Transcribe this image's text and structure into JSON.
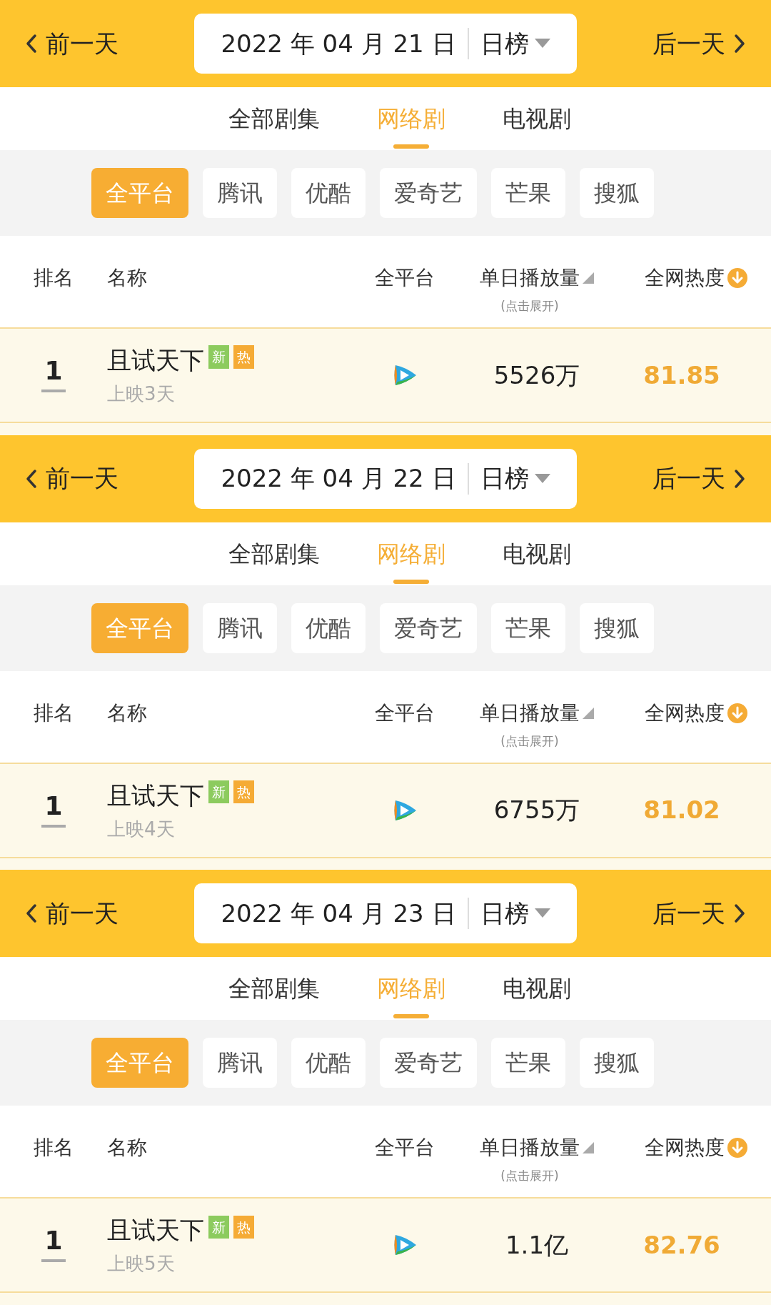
{
  "panels": [
    {
      "prev_day": "前一天",
      "date": "2022 年 04 月 21 日",
      "period": "日榜",
      "next_day": "后一天",
      "tabs": [
        {
          "label": "全部剧集",
          "selected": false
        },
        {
          "label": "网络剧",
          "selected": true
        },
        {
          "label": "电视剧",
          "selected": false
        }
      ],
      "platforms": [
        {
          "label": "全平台",
          "selected": true
        },
        {
          "label": "腾讯",
          "selected": false
        },
        {
          "label": "优酷",
          "selected": false
        },
        {
          "label": "爱奇艺",
          "selected": false
        },
        {
          "label": "芒果",
          "selected": false
        },
        {
          "label": "搜狐",
          "selected": false
        }
      ],
      "columns": [
        "排名",
        "名称",
        "全平台",
        "单日播放量",
        "全网热度"
      ],
      "expand_hint": "(点击展开)",
      "rows": [
        {
          "rank": "1",
          "title": "且试天下",
          "badges": [
            {
              "label": "新",
              "color": "#8ccb5e"
            },
            {
              "label": "热",
              "color": "#f5ab35"
            }
          ],
          "subtitle": "上映3天",
          "plays": "5526万",
          "heat": "81.85"
        }
      ]
    },
    {
      "prev_day": "前一天",
      "date": "2022 年 04 月 22 日",
      "period": "日榜",
      "next_day": "后一天",
      "tabs": [
        {
          "label": "全部剧集",
          "selected": false
        },
        {
          "label": "网络剧",
          "selected": true
        },
        {
          "label": "电视剧",
          "selected": false
        }
      ],
      "platforms": [
        {
          "label": "全平台",
          "selected": true
        },
        {
          "label": "腾讯",
          "selected": false
        },
        {
          "label": "优酷",
          "selected": false
        },
        {
          "label": "爱奇艺",
          "selected": false
        },
        {
          "label": "芒果",
          "selected": false
        },
        {
          "label": "搜狐",
          "selected": false
        }
      ],
      "columns": [
        "排名",
        "名称",
        "全平台",
        "单日播放量",
        "全网热度"
      ],
      "expand_hint": "(点击展开)",
      "rows": [
        {
          "rank": "1",
          "title": "且试天下",
          "badges": [
            {
              "label": "新",
              "color": "#8ccb5e"
            },
            {
              "label": "热",
              "color": "#f5ab35"
            }
          ],
          "subtitle": "上映4天",
          "plays": "6755万",
          "heat": "81.02"
        }
      ]
    },
    {
      "prev_day": "前一天",
      "date": "2022 年 04 月 23 日",
      "period": "日榜",
      "next_day": "后一天",
      "tabs": [
        {
          "label": "全部剧集",
          "selected": false
        },
        {
          "label": "网络剧",
          "selected": true
        },
        {
          "label": "电视剧",
          "selected": false
        }
      ],
      "platforms": [
        {
          "label": "全平台",
          "selected": true
        },
        {
          "label": "腾讯",
          "selected": false
        },
        {
          "label": "优酷",
          "selected": false
        },
        {
          "label": "爱奇艺",
          "selected": false
        },
        {
          "label": "芒果",
          "selected": false
        },
        {
          "label": "搜狐",
          "selected": false
        }
      ],
      "columns": [
        "排名",
        "名称",
        "全平台",
        "单日播放量",
        "全网热度"
      ],
      "expand_hint": "(点击展开)",
      "rows": [
        {
          "rank": "1",
          "title": "且试天下",
          "badges": [
            {
              "label": "新",
              "color": "#8ccb5e"
            },
            {
              "label": "热",
              "color": "#f5ab35"
            }
          ],
          "subtitle": "上映5天",
          "plays": "1.1亿",
          "heat": "82.76"
        }
      ]
    }
  ]
}
